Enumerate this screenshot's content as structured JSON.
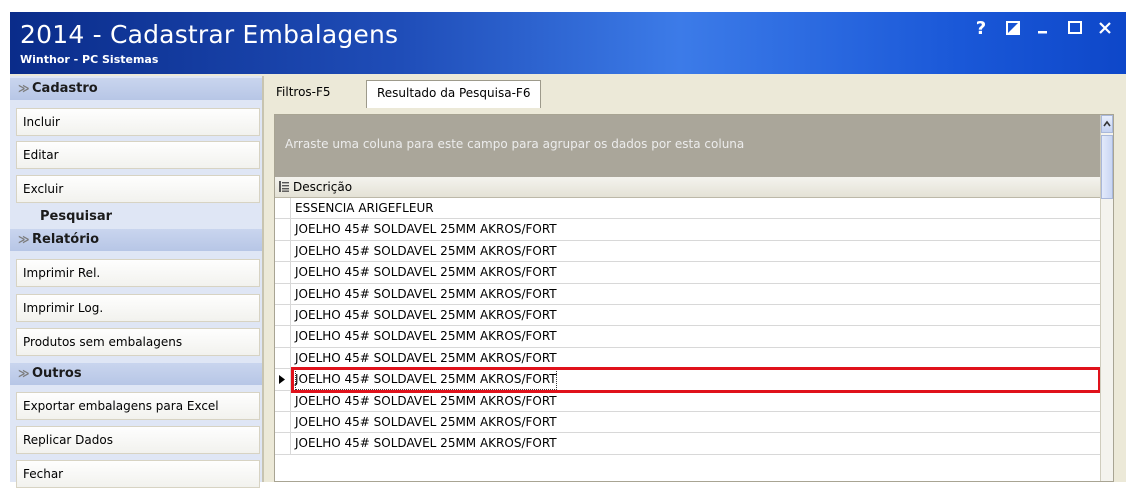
{
  "window": {
    "title": "2014 - Cadastrar Embalagens",
    "subtitle": "Winthor - PC Sistemas",
    "controls": [
      "?",
      "restore",
      "_",
      "maximize",
      "X"
    ]
  },
  "sidebar": {
    "cadastro_header": "Cadastro",
    "incluir": "Incluir",
    "editar": "Editar",
    "excluir": "Excluir",
    "pesquisar": "Pesquisar",
    "relatorio_header": "Relatório",
    "imprimir_rel": "Imprimir Rel.",
    "imprimir_log": "Imprimir Log.",
    "produtos_sem_embalagens": "Produtos sem embalagens",
    "outros_header": "Outros",
    "exportar": "Exportar embalagens para Excel",
    "replicar": "Replicar Dados",
    "fechar": "Fechar"
  },
  "tabs": {
    "filtros": "Filtros-F5",
    "resultado": "Resultado da Pesquisa-F6"
  },
  "grid": {
    "group_hint": "Arraste uma coluna para este campo para agrupar os dados por esta coluna",
    "column_header": "Descrição",
    "rows": [
      "ESSENCIA ARIGEFLEUR",
      "JOELHO 45# SOLDAVEL  25MM AKROS/FORT",
      "JOELHO 45# SOLDAVEL  25MM AKROS/FORT",
      "JOELHO 45# SOLDAVEL  25MM AKROS/FORT",
      "JOELHO 45# SOLDAVEL  25MM AKROS/FORT",
      "JOELHO 45# SOLDAVEL  25MM AKROS/FORT",
      "JOELHO 45# SOLDAVEL  25MM AKROS/FORT",
      "JOELHO 45# SOLDAVEL  25MM AKROS/FORT",
      "JOELHO 45# SOLDAVEL  25MM AKROS/FORT",
      "JOELHO 45# SOLDAVEL  25MM AKROS/FORT",
      "JOELHO 45# SOLDAVEL  25MM AKROS/FORT",
      "JOELHO 45# SOLDAVEL  25MM AKROS/FORT"
    ],
    "selected_row_index": 8,
    "highlight_color": "#e0121b"
  }
}
